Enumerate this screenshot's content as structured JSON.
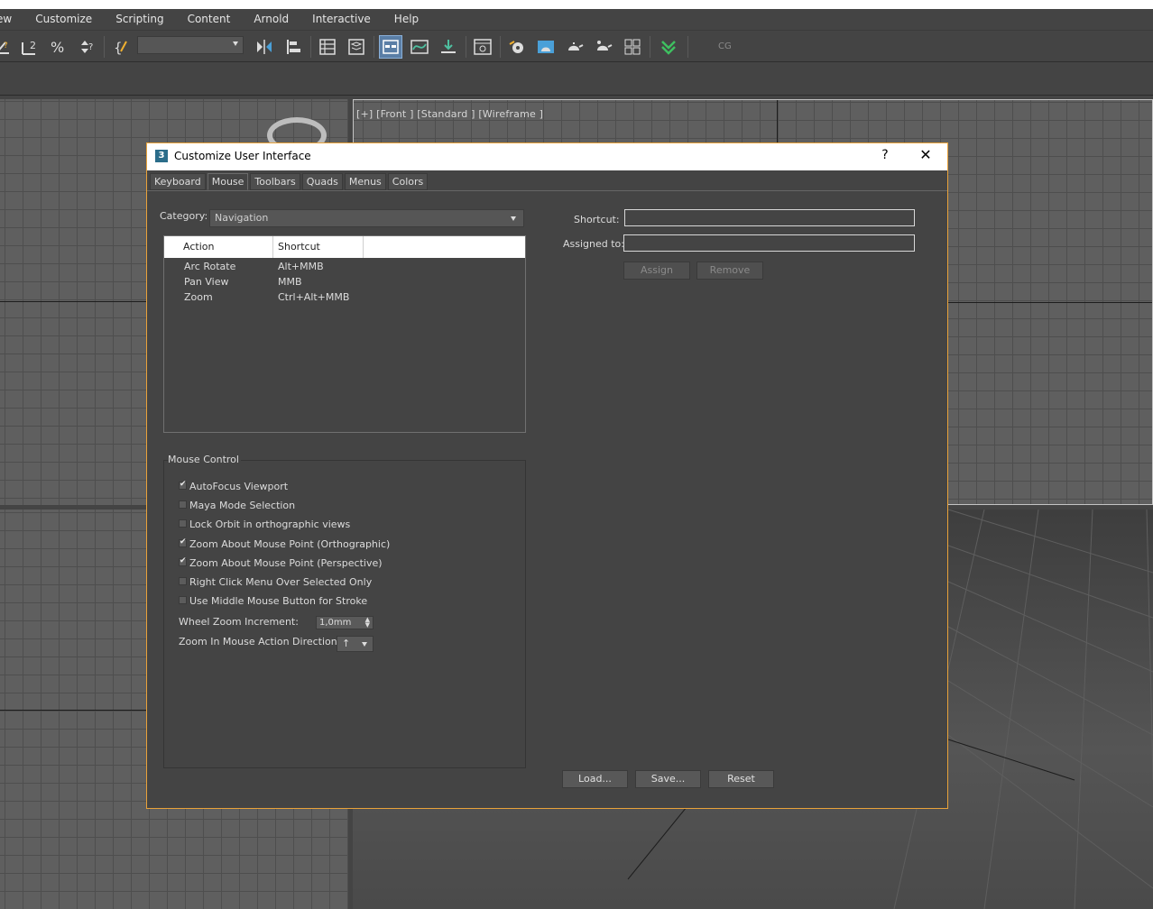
{
  "menubar": {
    "items": [
      "ew",
      "Customize",
      "Scripting",
      "Content",
      "Arnold",
      "Interactive",
      "Help"
    ]
  },
  "toolbar": {
    "icons": [
      "snap-angle-icon",
      "snap-percent-icon",
      "snap-spinner-icon",
      "edit-named-selection-icon",
      "mirror-icon",
      "align-icon",
      "scene-explorer-icon",
      "layer-explorer-icon",
      "toggle-ribbon-icon",
      "curve-editor-icon",
      "schematic-view-icon",
      "material-editor-icon",
      "render-setup-icon",
      "rendered-frame-window-icon",
      "render-production-icon",
      "render-iterative-icon",
      "render-cloud-icon",
      "arnold-icon"
    ],
    "tag": "CG"
  },
  "viewport": {
    "front_label": "[+] [Front ] [Standard ] [Wireframe ]"
  },
  "dialog": {
    "title": "Customize User Interface",
    "help_glyph": "?",
    "close_glyph": "✕",
    "tabs": [
      "Keyboard",
      "Mouse",
      "Toolbars",
      "Quads",
      "Menus",
      "Colors"
    ],
    "selected_tab": "Mouse",
    "category_label": "Category:",
    "category_value": "Navigation",
    "columns": [
      "Action",
      "Shortcut"
    ],
    "rows": [
      {
        "action": "Arc Rotate",
        "shortcut": "Alt+MMB"
      },
      {
        "action": "Pan View",
        "shortcut": "MMB"
      },
      {
        "action": "Zoom",
        "shortcut": "Ctrl+Alt+MMB"
      }
    ],
    "mouse_control": {
      "legend": "Mouse Control",
      "checkboxes": [
        {
          "label": "AutoFocus Viewport",
          "checked": true
        },
        {
          "label": "Maya Mode Selection",
          "checked": false
        },
        {
          "label": "Lock Orbit in orthographic views",
          "checked": false
        },
        {
          "label": "Zoom About Mouse Point (Orthographic)",
          "checked": true
        },
        {
          "label": "Zoom About Mouse Point (Perspective)",
          "checked": true
        },
        {
          "label": "Right Click Menu Over Selected Only",
          "checked": false
        },
        {
          "label": "Use Middle Mouse Button for Stroke",
          "checked": false
        }
      ],
      "wheel_zoom_label": "Wheel Zoom Increment:",
      "wheel_zoom_value": "1,0mm",
      "zoom_dir_label": "Zoom In Mouse Action Direction:",
      "zoom_dir_value": "↑"
    },
    "shortcut_label": "Shortcut:",
    "assigned_label": "Assigned to:",
    "assign_button": "Assign",
    "remove_button": "Remove",
    "load_button": "Load...",
    "save_button": "Save...",
    "reset_button": "Reset"
  }
}
